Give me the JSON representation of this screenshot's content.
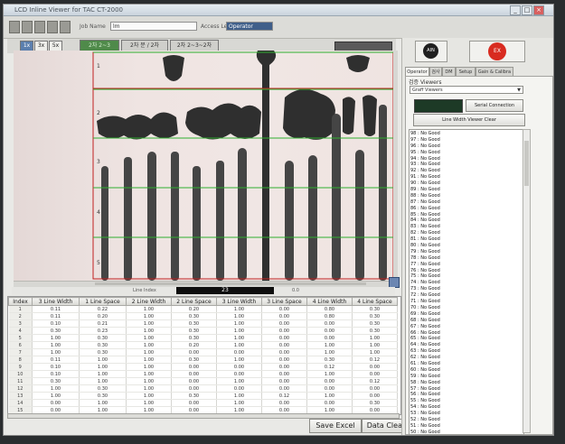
{
  "window": {
    "title": "LCD Inline Viewer for TAC CT-2000"
  },
  "toolbar": {
    "job_label": "Job Name",
    "job_value": "lm",
    "access_label": "Access Level",
    "access_value": "Operator"
  },
  "zoom_buttons": [
    "1x",
    "3x",
    "5x"
  ],
  "mode_buttons": [
    "2차 2~3",
    "2차 분 / 2차",
    "2차 2~3~2차"
  ],
  "viewer": {
    "row_labels": [
      "1",
      "2",
      "3",
      "4",
      "5"
    ]
  },
  "status": {
    "label": "Line Index",
    "value": "23",
    "value2": "0.0"
  },
  "table": {
    "columns": [
      "Index",
      "3 Line Width",
      "1 Line Space",
      "2 Line Width",
      "2 Line Space",
      "3 Line Width",
      "3 Line Space",
      "4 Line Width",
      "4 Line Space"
    ],
    "rows": [
      [
        "1",
        "0.11",
        "0.22",
        "1.00",
        "0.20",
        "1.00",
        "0.00",
        "0.80",
        "0.30"
      ],
      [
        "2",
        "0.11",
        "0.20",
        "1.00",
        "0.30",
        "1.00",
        "0.00",
        "0.80",
        "0.30"
      ],
      [
        "3",
        "0.10",
        "0.21",
        "1.00",
        "0.30",
        "1.00",
        "0.00",
        "0.00",
        "0.30"
      ],
      [
        "4",
        "0.30",
        "0.23",
        "1.00",
        "0.30",
        "1.00",
        "0.00",
        "0.00",
        "0.30"
      ],
      [
        "5",
        "1.00",
        "0.30",
        "1.00",
        "0.30",
        "1.00",
        "0.00",
        "0.00",
        "1.00"
      ],
      [
        "6",
        "1.00",
        "0.30",
        "1.00",
        "0.20",
        "1.00",
        "0.00",
        "1.00",
        "1.00"
      ],
      [
        "7",
        "1.00",
        "0.30",
        "1.00",
        "0.00",
        "0.00",
        "0.00",
        "1.00",
        "1.00"
      ],
      [
        "8",
        "0.11",
        "1.00",
        "1.00",
        "0.30",
        "1.00",
        "0.00",
        "0.30",
        "0.12"
      ],
      [
        "9",
        "0.10",
        "1.00",
        "1.00",
        "0.00",
        "0.00",
        "0.00",
        "0.12",
        "0.00"
      ],
      [
        "10",
        "0.10",
        "1.00",
        "1.00",
        "0.00",
        "0.00",
        "0.00",
        "1.00",
        "0.00"
      ],
      [
        "11",
        "0.30",
        "1.00",
        "1.00",
        "0.00",
        "1.00",
        "0.00",
        "0.00",
        "0.12"
      ],
      [
        "12",
        "1.00",
        "0.30",
        "1.00",
        "0.00",
        "0.00",
        "0.00",
        "0.00",
        "0.00"
      ],
      [
        "13",
        "1.00",
        "0.30",
        "1.00",
        "0.30",
        "1.00",
        "0.12",
        "1.00",
        "0.00"
      ],
      [
        "14",
        "0.00",
        "1.00",
        "1.00",
        "0.00",
        "1.00",
        "0.00",
        "0.00",
        "0.30"
      ],
      [
        "15",
        "0.00",
        "1.00",
        "1.00",
        "0.00",
        "1.00",
        "0.00",
        "1.00",
        "0.00"
      ],
      [
        "16",
        "0.00",
        "1.00",
        "1.00",
        "0.00",
        "1.00",
        "0.00",
        "1.00",
        "0.30"
      ]
    ]
  },
  "actions": {
    "save_excel": "Save Excel",
    "data_clear": "Data Clear"
  },
  "right_panel": {
    "ain_label": "AIN",
    "stop_label": "EX",
    "tabs": [
      "Operator",
      "검사",
      "DM",
      "Setup",
      "Gain & Calibra"
    ],
    "group_label": "검증 Viewers",
    "viewer_select": "Graff Viewers",
    "serial_button": "Serial Connection",
    "clear_button": "Line Width Viewer Clear",
    "log": [
      "98 : No Good",
      "97 : No Good",
      "96 : No Good",
      "95 : No Good",
      "94 : No Good",
      "93 : No Good",
      "92 : No Good",
      "91 : No Good",
      "90 : No Good",
      "89 : No Good",
      "88 : No Good",
      "87 : No Good",
      "86 : No Good",
      "85 : No Good",
      "84 : No Good",
      "83 : No Good",
      "82 : No Good",
      "81 : No Good",
      "80 : No Good",
      "79 : No Good",
      "78 : No Good",
      "77 : No Good",
      "76 : No Good",
      "75 : No Good",
      "74 : No Good",
      "73 : No Good",
      "72 : No Good",
      "71 : No Good",
      "70 : No Good",
      "69 : No Good",
      "68 : No Good",
      "67 : No Good",
      "66 : No Good",
      "65 : No Good",
      "64 : No Good",
      "63 : No Good",
      "62 : No Good",
      "61 : No Good",
      "60 : No Good",
      "59 : No Good",
      "58 : No Good",
      "57 : No Good",
      "56 : No Good",
      "55 : No Good",
      "54 : No Good",
      "53 : No Good",
      "52 : No Good",
      "51 : No Good",
      "50 : No Good",
      "49 : No Good",
      "48 : No Good",
      "47 : No Good"
    ]
  }
}
